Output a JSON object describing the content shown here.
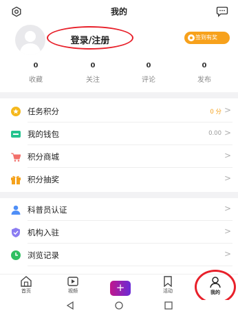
{
  "header": {
    "title": "我的",
    "settings_icon": "gear-icon",
    "message_icon": "chat-bubble-icon"
  },
  "profile": {
    "login_label": "登录/注册",
    "checkin_label": "签到有奖"
  },
  "stats": [
    {
      "value": "0",
      "label": "收藏"
    },
    {
      "value": "0",
      "label": "关注"
    },
    {
      "value": "0",
      "label": "评论"
    },
    {
      "value": "0",
      "label": "发布"
    }
  ],
  "menu_group_1": [
    {
      "label": "任务积分",
      "value": "0 分",
      "icon": "star-coin-icon",
      "color": "#f5b81c"
    },
    {
      "label": "我的钱包",
      "value": "0.00",
      "icon": "wallet-icon",
      "color": "#23c38e"
    },
    {
      "label": "积分商城",
      "value": "",
      "icon": "cart-icon",
      "color": "#f2706b"
    },
    {
      "label": "积分抽奖",
      "value": "",
      "icon": "gift-icon",
      "color": "#f5a21c"
    }
  ],
  "menu_group_2": [
    {
      "label": "科普员认证",
      "value": "",
      "icon": "user-icon",
      "color": "#4f8ff7"
    },
    {
      "label": "机构入驻",
      "value": "",
      "icon": "shield-icon",
      "color": "#8b7cf2"
    },
    {
      "label": "浏览记录",
      "value": "",
      "icon": "clock-icon",
      "color": "#2fbf62"
    }
  ],
  "tabbar": [
    {
      "label": "首页",
      "icon": "home-icon"
    },
    {
      "label": "视频",
      "icon": "video-icon"
    },
    {
      "label": "+",
      "icon": "plus-icon"
    },
    {
      "label": "活动",
      "icon": "bookmark-icon"
    },
    {
      "label": "我的",
      "icon": "person-icon"
    }
  ],
  "colors": {
    "accent_orange": "#f7a11c",
    "annotation_red": "#e8202a"
  }
}
